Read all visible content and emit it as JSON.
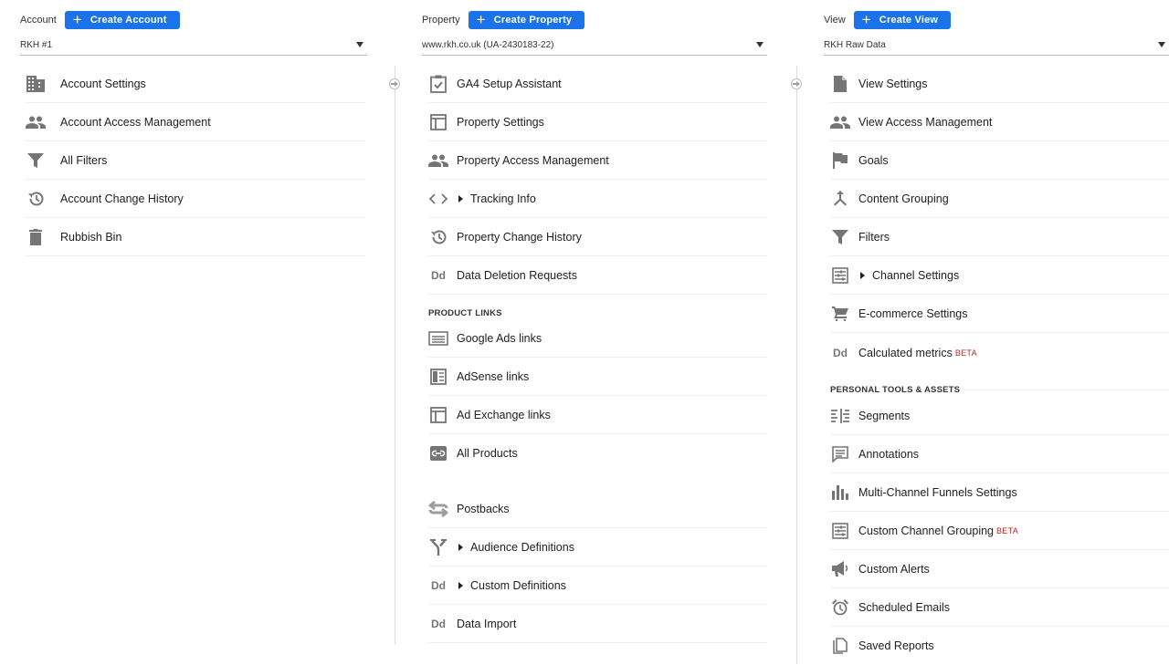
{
  "colors": {
    "accent": "#1a73e8",
    "icon": "#757575",
    "beta": "#c5221f"
  },
  "account": {
    "label": "Account",
    "create_label": "Create Account",
    "selected": "RKH #1",
    "items": [
      {
        "label": "Account Settings",
        "icon": "building-icon"
      },
      {
        "label": "Account Access Management",
        "icon": "people-icon"
      },
      {
        "label": "All Filters",
        "icon": "filter-icon"
      },
      {
        "label": "Account Change History",
        "icon": "history-icon"
      },
      {
        "label": "Rubbish Bin",
        "icon": "trash-icon"
      }
    ]
  },
  "property": {
    "label": "Property",
    "create_label": "Create Property",
    "selected": "www.rkh.co.uk (UA-2430183-22)",
    "items": [
      {
        "label": "GA4 Setup Assistant",
        "icon": "checklist-icon"
      },
      {
        "label": "Property Settings",
        "icon": "layout-icon"
      },
      {
        "label": "Property Access Management",
        "icon": "people-icon"
      },
      {
        "label": "Tracking Info",
        "icon": "code-icon"
      },
      {
        "label": "Property Change History",
        "icon": "history-icon"
      },
      {
        "label": "Data Deletion Requests",
        "icon": "dd-icon"
      }
    ],
    "product_links_heading": "PRODUCT LINKS",
    "product_links": [
      {
        "label": "Google Ads links",
        "icon": "ads-icon"
      },
      {
        "label": "AdSense links",
        "icon": "adsense-icon"
      },
      {
        "label": "Ad Exchange links",
        "icon": "layout-icon"
      },
      {
        "label": "All Products",
        "icon": "link-icon"
      }
    ],
    "more_items": [
      {
        "label": "Postbacks",
        "icon": "swap-icon"
      },
      {
        "label": "Audience Definitions",
        "icon": "fork-icon"
      },
      {
        "label": "Custom Definitions",
        "icon": "dd-icon"
      },
      {
        "label": "Data Import",
        "icon": "dd-icon"
      }
    ]
  },
  "view": {
    "label": "View",
    "create_label": "Create View",
    "selected": "RKH Raw Data",
    "items": [
      {
        "label": "View Settings",
        "icon": "document-icon"
      },
      {
        "label": "View Access Management",
        "icon": "people-icon"
      },
      {
        "label": "Goals",
        "icon": "flag-icon"
      },
      {
        "label": "Content Grouping",
        "icon": "merge-icon"
      },
      {
        "label": "Filters",
        "icon": "filter-icon"
      },
      {
        "label": "Channel Settings",
        "icon": "channel-icon"
      },
      {
        "label": "E-commerce Settings",
        "icon": "cart-icon"
      },
      {
        "label": "Calculated metrics",
        "icon": "dd-icon",
        "badge": "BETA"
      }
    ],
    "tools_heading": "PERSONAL TOOLS & ASSETS",
    "tools": [
      {
        "label": "Segments",
        "icon": "segments-icon"
      },
      {
        "label": "Annotations",
        "icon": "comment-icon"
      },
      {
        "label": "Multi-Channel Funnels Settings",
        "icon": "bar-chart-icon"
      },
      {
        "label": "Custom Channel Grouping",
        "icon": "channel-icon",
        "badge": "BETA"
      },
      {
        "label": "Custom Alerts",
        "icon": "megaphone-icon"
      },
      {
        "label": "Scheduled Emails",
        "icon": "alarm-icon"
      },
      {
        "label": "Saved Reports",
        "icon": "copy-icon"
      }
    ]
  }
}
